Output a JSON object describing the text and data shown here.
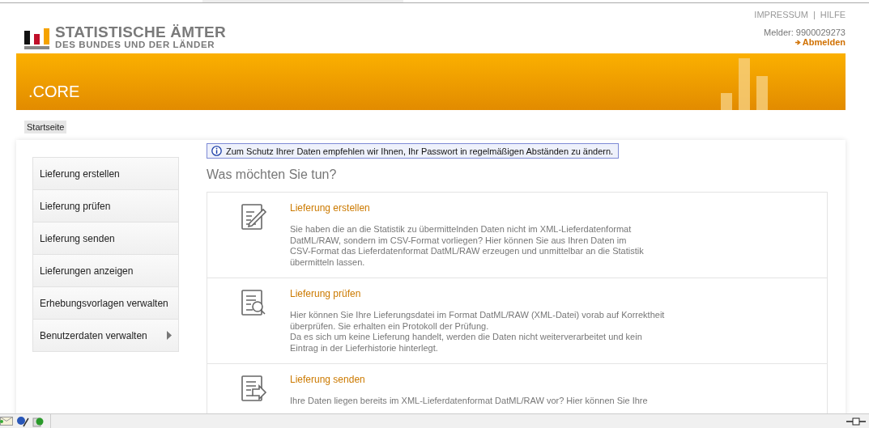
{
  "logo": {
    "line_1": "STATISTISCHE ÄMTER",
    "line_2": "DES BUNDES UND DER LÄNDER"
  },
  "top_links": [
    "IMPRESSUM",
    "HILFE"
  ],
  "separator": "|",
  "user": {
    "label": "Melder: 9900029273",
    "logout": "Abmelden"
  },
  "banner": {
    "title": ".CORE"
  },
  "breadcrumb": [
    "Startseite"
  ],
  "sidebar": {
    "items": [
      {
        "label": "Lieferung erstellen",
        "has_submenu": false
      },
      {
        "label": "Lieferung prüfen",
        "has_submenu": false
      },
      {
        "label": "Lieferung senden",
        "has_submenu": false
      },
      {
        "label": "Lieferungen anzeigen",
        "has_submenu": false
      },
      {
        "label": "Erhebungsvorlagen verwalten",
        "has_submenu": false
      },
      {
        "label": "Benutzerdaten verwalten",
        "has_submenu": true
      }
    ]
  },
  "notice": "Zum Schutz Ihrer Daten empfehlen wir Ihnen, Ihr Passwort in regelmäßigen Abständen zu ändern.",
  "heading": "Was möchten Sie tun?",
  "actions": [
    {
      "kind": "create",
      "title": "Lieferung erstellen",
      "lines": [
        "Sie haben die an die Statistik zu übermittelnden Daten nicht im XML-Lieferdatenformat",
        "DatML/RAW, sondern im CSV-Format vorliegen? Hier können Sie aus Ihren Daten im",
        "CSV-Format das Lieferdatenformat DatML/RAW erzeugen und unmittelbar an die Statistik",
        "übermitteln lassen."
      ]
    },
    {
      "kind": "check",
      "title": "Lieferung prüfen",
      "lines": [
        "Hier können Sie Ihre Lieferungsdatei im Format DatML/RAW (XML-Datei) vorab auf Korrektheit",
        "überprüfen. Sie erhalten ein Protokoll der Prüfung.",
        "Da es sich um keine Lieferung handelt, werden die Daten nicht weiterverarbeitet und kein",
        "Eintrag in der Lieferhistorie hinterlegt."
      ]
    },
    {
      "kind": "send",
      "title": "Lieferung senden",
      "lines": [
        "Ihre Daten liegen bereits im XML-Lieferdatenformat DatML/RAW vor? Hier können Sie Ihre"
      ]
    }
  ]
}
